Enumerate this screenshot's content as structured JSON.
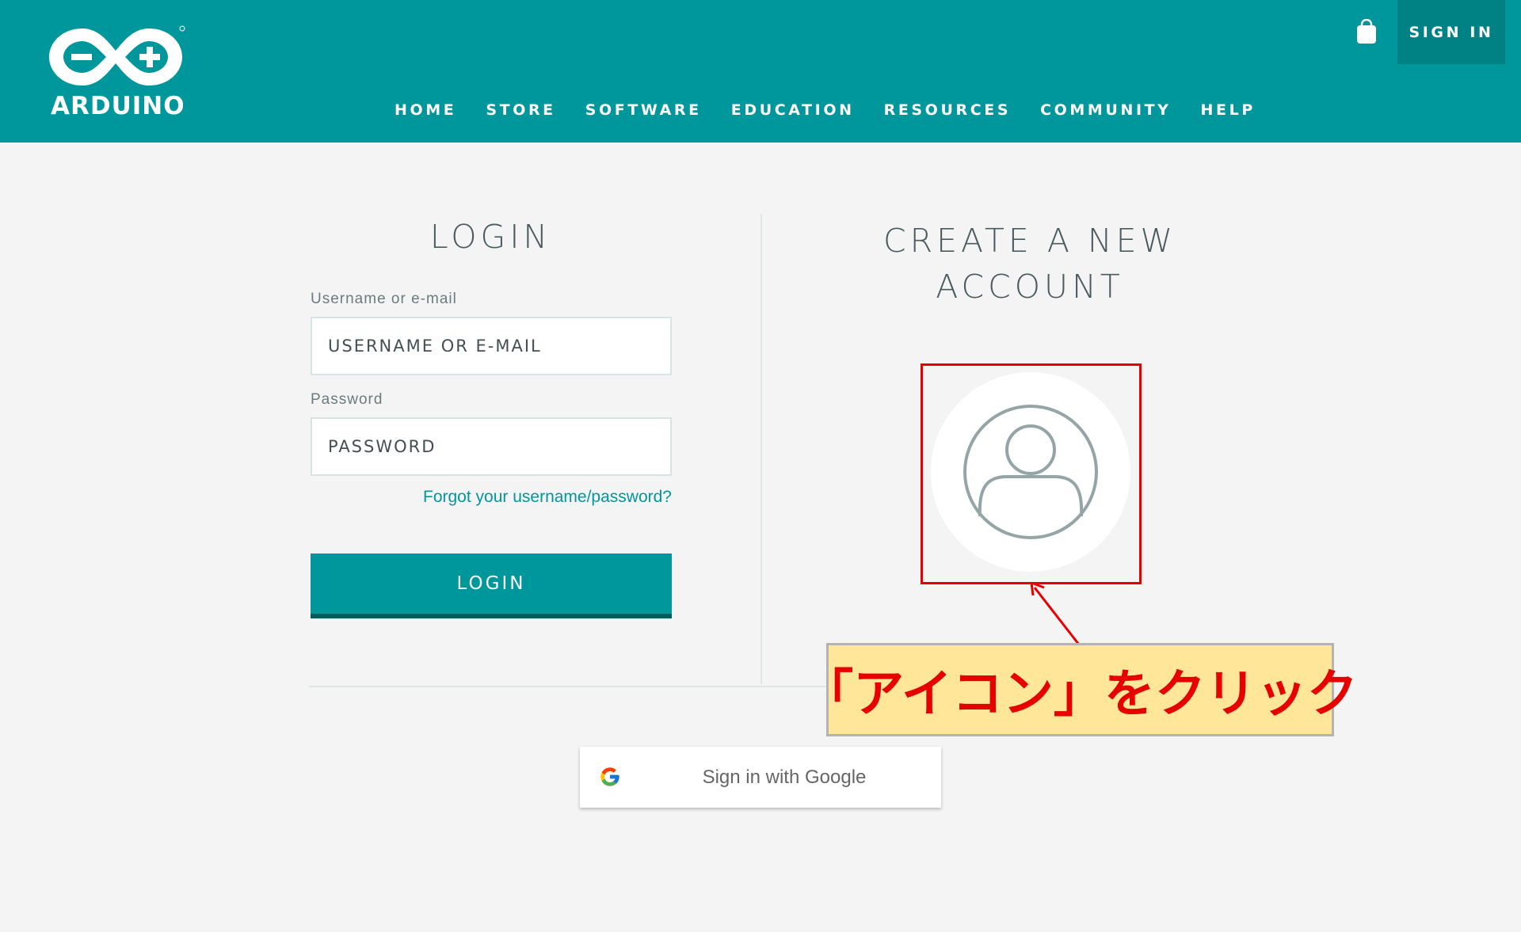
{
  "header": {
    "logo_text": "ARDUINO",
    "nav": [
      "HOME",
      "STORE",
      "SOFTWARE",
      "EDUCATION",
      "RESOURCES",
      "COMMUNITY",
      "HELP"
    ],
    "sign_in": "SIGN IN",
    "brand_color": "#00979c"
  },
  "login": {
    "title": "LOGIN",
    "username_label": "Username or e-mail",
    "username_placeholder": "USERNAME OR E-MAIL",
    "password_label": "Password",
    "password_placeholder": "PASSWORD",
    "forgot": "Forgot your username/password?",
    "button": "LOGIN"
  },
  "create": {
    "title_line1": "CREATE A NEW",
    "title_line2": "ACCOUNT"
  },
  "annotation": {
    "text": "「アイコン」をクリック",
    "color": "#e60000"
  },
  "google": {
    "label": "Sign in with Google"
  }
}
